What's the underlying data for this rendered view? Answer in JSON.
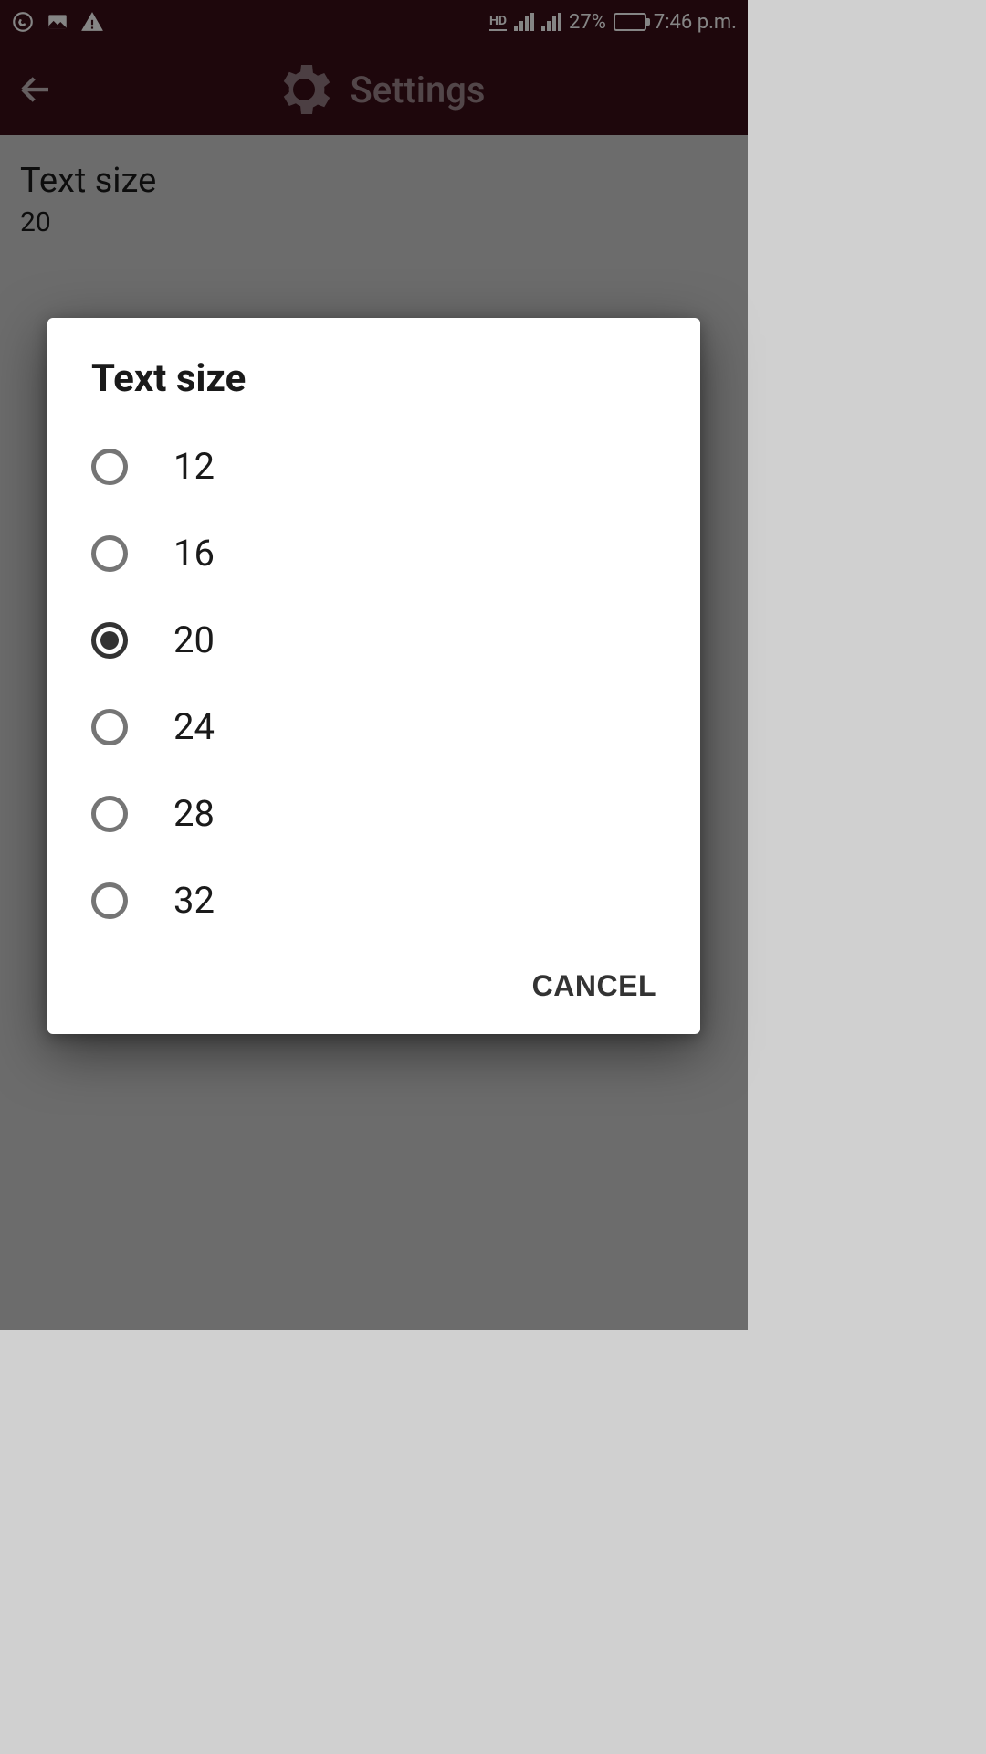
{
  "status": {
    "hd": "HD",
    "battery_pct": "27%",
    "time": "7:46 p.m."
  },
  "appbar": {
    "title": "Settings"
  },
  "pref": {
    "title": "Text size",
    "value": "20"
  },
  "dialog": {
    "title": "Text size",
    "options": [
      {
        "label": "12",
        "selected": false
      },
      {
        "label": "16",
        "selected": false
      },
      {
        "label": "20",
        "selected": true
      },
      {
        "label": "24",
        "selected": false
      },
      {
        "label": "28",
        "selected": false
      },
      {
        "label": "32",
        "selected": false
      }
    ],
    "cancel": "CANCEL"
  }
}
